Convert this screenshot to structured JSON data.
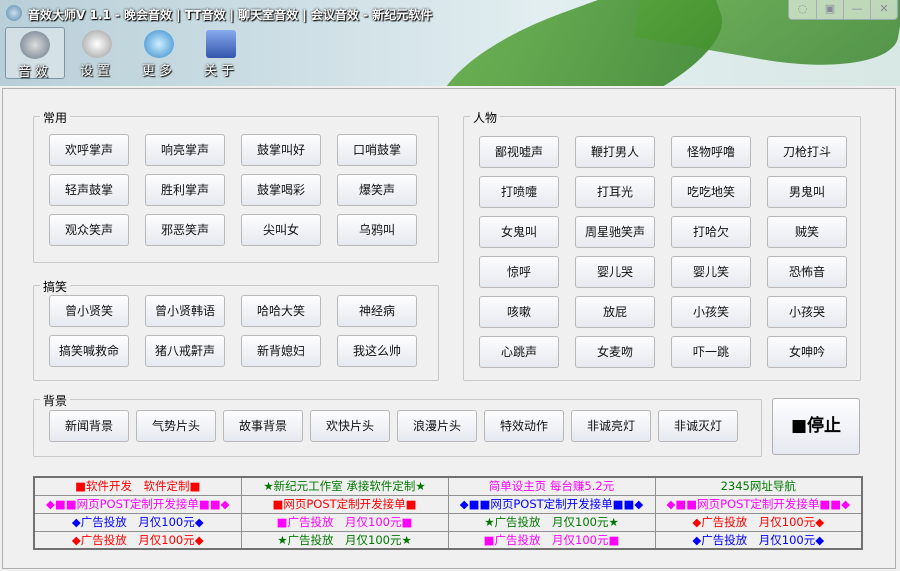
{
  "window": {
    "title": "音效大师V 1.1 - 晚会音效 | TT音效 | 聊天室音效 | 会议音效 - 新纪元软件"
  },
  "toolbar": [
    {
      "label": "音效",
      "icon": "headphones-icon",
      "active": true
    },
    {
      "label": "设置",
      "icon": "gear-icon"
    },
    {
      "label": "更多",
      "icon": "search-document-icon"
    },
    {
      "label": "关于",
      "icon": "at-sign-icon"
    }
  ],
  "window_controls": [
    {
      "name": "chat-icon",
      "glyph": "◌"
    },
    {
      "name": "skin-icon",
      "glyph": "▣"
    },
    {
      "name": "minimize-icon",
      "glyph": "—"
    },
    {
      "name": "close-icon",
      "glyph": "✕"
    }
  ],
  "groups": {
    "common": {
      "title": "常用",
      "buttons": [
        "欢呼掌声",
        "响亮掌声",
        "鼓掌叫好",
        "口哨鼓掌",
        "轻声鼓掌",
        "胜利掌声",
        "鼓掌喝彩",
        "爆笑声",
        "观众笑声",
        "邪恶笑声",
        "尖叫女",
        "乌鸦叫"
      ]
    },
    "funny": {
      "title": "搞笑",
      "buttons": [
        "曾小贤笑",
        "曾小贤韩语",
        "哈哈大笑",
        "神经病",
        "搞笑喊救命",
        "猪八戒鼾声",
        "新背媳妇",
        "我这么帅"
      ]
    },
    "background": {
      "title": "背景",
      "buttons": [
        "新闻背景",
        "气势片头",
        "故事背景",
        "欢快片头",
        "浪漫片头",
        "特效动作",
        "非诚亮灯",
        "非诚灭灯"
      ]
    },
    "people": {
      "title": "人物",
      "buttons": [
        "鄙视嘘声",
        "鞭打男人",
        "怪物呼噜",
        "刀枪打斗",
        "打喷嚏",
        "打耳光",
        "吃吃地笑",
        "男鬼叫",
        "女鬼叫",
        "周星驰笑声",
        "打哈欠",
        "贼笑",
        "惊呼",
        "婴儿哭",
        "婴儿笑",
        "恐怖音",
        "咳嗽",
        "放屁",
        "小孩笑",
        "小孩哭",
        "心跳声",
        "女麦吻",
        "吓一跳",
        "女呻吟"
      ]
    }
  },
  "stop_button": "■停止",
  "ads": [
    [
      {
        "text": "■软件开发　软件定制■",
        "color": "#ff0000"
      },
      {
        "text": "★新纪元工作室 承接软件定制★",
        "color": "#007700"
      },
      {
        "text": "简单设主页 每台赚5.2元",
        "color": "#ff00ff"
      },
      {
        "text": "2345网址导航",
        "color": "#007700"
      }
    ],
    [
      {
        "text": "◆■■网页POST定制开发接单■■◆",
        "color": "#ff00ff"
      },
      {
        "text": "■网页POST定制开发接单■",
        "color": "#ff0000"
      },
      {
        "text": "◆■■网页POST定制开发接单■■◆",
        "color": "#0000ff"
      },
      {
        "text": "◆■■网页POST定制开发接单■■◆",
        "color": "#ff00ff"
      }
    ],
    [
      {
        "text": "◆广告投放　月仅100元◆",
        "color": "#0000ff"
      },
      {
        "text": "■广告投放　月仅100元■",
        "color": "#ff00ff"
      },
      {
        "text": "★广告投放　月仅100元★",
        "color": "#007700"
      },
      {
        "text": "◆广告投放　月仅100元◆",
        "color": "#ff0000"
      }
    ],
    [
      {
        "text": "◆广告投放　月仅100元◆",
        "color": "#ff0000"
      },
      {
        "text": "★广告投放　月仅100元★",
        "color": "#007700"
      },
      {
        "text": "■广告投放　月仅100元■",
        "color": "#ff00ff"
      },
      {
        "text": "◆广告投放　月仅100元◆",
        "color": "#0000ff"
      }
    ]
  ]
}
